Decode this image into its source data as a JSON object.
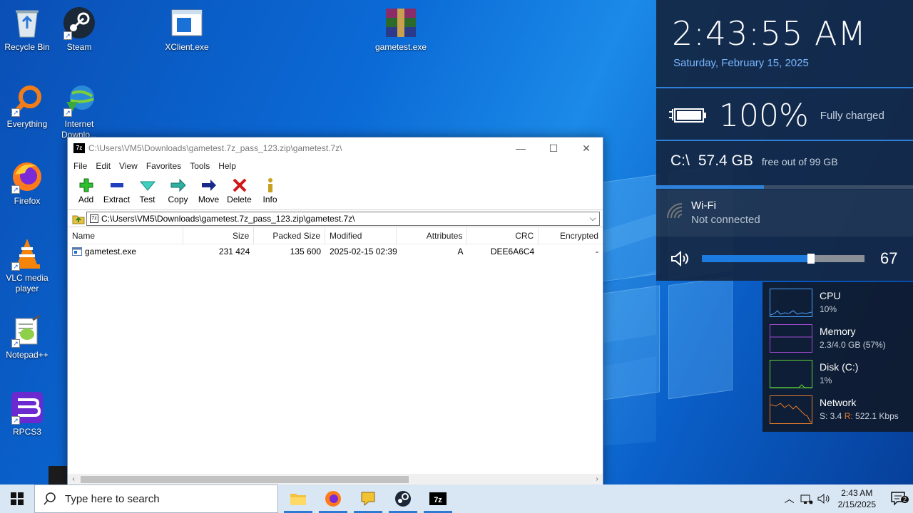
{
  "desktop": {
    "icons": [
      {
        "label": "Recycle Bin"
      },
      {
        "label": "Steam"
      },
      {
        "label": "XClient.exe"
      },
      {
        "label": "gametest.exe"
      },
      {
        "label": "Everything"
      },
      {
        "label": "Internet Downlo..."
      },
      {
        "label": "Firefox"
      },
      {
        "label": "VLC media player"
      },
      {
        "label": "Notepad++"
      },
      {
        "label": "RPCS3"
      }
    ]
  },
  "window": {
    "title": "C:\\Users\\VM5\\Downloads\\gametest.7z_pass_123.zip\\gametest.7z\\",
    "app_icon_text": "7z",
    "menu": [
      "File",
      "Edit",
      "View",
      "Favorites",
      "Tools",
      "Help"
    ],
    "toolbar": [
      {
        "label": "Add",
        "icon": "add-icon"
      },
      {
        "label": "Extract",
        "icon": "extract-icon"
      },
      {
        "label": "Test",
        "icon": "test-icon"
      },
      {
        "label": "Copy",
        "icon": "copy-icon"
      },
      {
        "label": "Move",
        "icon": "move-icon"
      },
      {
        "label": "Delete",
        "icon": "delete-icon"
      },
      {
        "label": "Info",
        "icon": "info-icon"
      }
    ],
    "address": "C:\\Users\\VM5\\Downloads\\gametest.7z_pass_123.zip\\gametest.7z\\",
    "columns": [
      "Name",
      "Size",
      "Packed Size",
      "Modified",
      "Attributes",
      "CRC",
      "Encrypted"
    ],
    "files": [
      {
        "name": "gametest.exe",
        "size": "231 424",
        "packed": "135 600",
        "modified": "2025-02-15 02:39",
        "attributes": "A",
        "crc": "DEE6A6C4",
        "encrypted": "-"
      }
    ]
  },
  "widget": {
    "time": "2:43:55 AM",
    "date": "Saturday, February 15, 2025",
    "battery_percent": "100%",
    "battery_status": "Fully charged",
    "disk_label": "C:\\",
    "disk_free": "57.4 GB",
    "disk_total": "free out of 99 GB",
    "disk_used_fraction": 0.42,
    "wifi_name": "Wi-Fi",
    "wifi_status": "Not connected",
    "volume": "67",
    "volume_level": 0.67
  },
  "perf": [
    {
      "name": "CPU",
      "value": "10%",
      "color": "#4aa3ff"
    },
    {
      "name": "Memory",
      "value": "2.3/4.0 GB (57%)",
      "color": "#a34ad0"
    },
    {
      "name": "Disk (C:)",
      "value": "1%",
      "color": "#5fd03a"
    },
    {
      "name": "Network",
      "value_s": "S: 3.4",
      "value_r_label": "R:",
      "value_r": "522.1 Kbps",
      "color": "#e07a2a"
    }
  ],
  "taskbar": {
    "search_placeholder": "Type here to search",
    "time": "2:43 AM",
    "date": "2/15/2025",
    "notification_count": "2"
  },
  "colors": {
    "accent": "#2f80d8",
    "taskbar": "#d9e6f4"
  }
}
